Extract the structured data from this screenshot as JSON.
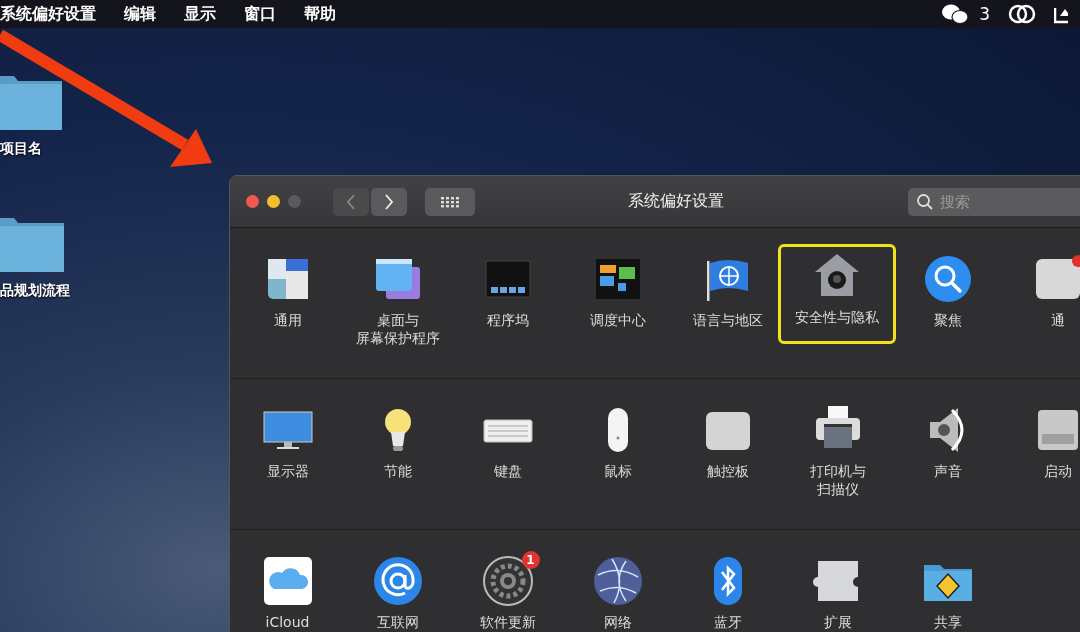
{
  "menu_bar": {
    "app_name": "系统偏好设置",
    "menus": [
      "编辑",
      "显示",
      "窗口",
      "帮助"
    ],
    "chat_count": "3"
  },
  "desktop_items": [
    {
      "label": "项目名"
    },
    {
      "label": "品规划流程"
    }
  ],
  "window": {
    "title": "系统偏好设置",
    "search": {
      "placeholder": "搜索"
    },
    "rows": [
      [
        {
          "label": "通用",
          "highlighted": false
        },
        {
          "label": [
            "桌面与",
            "屏幕保护程序"
          ],
          "highlighted": false
        },
        {
          "label": "程序坞",
          "highlighted": false
        },
        {
          "label": "调度中心",
          "highlighted": false
        },
        {
          "label": "语言与地区",
          "highlighted": false
        },
        {
          "label": "安全性与隐私",
          "highlighted": true
        },
        {
          "label": "聚焦",
          "highlighted": false
        },
        {
          "label": "通",
          "highlighted": false
        }
      ],
      [
        {
          "label": "显示器",
          "highlighted": false
        },
        {
          "label": "节能",
          "highlighted": false
        },
        {
          "label": "键盘",
          "highlighted": false
        },
        {
          "label": "鼠标",
          "highlighted": false
        },
        {
          "label": "触控板",
          "highlighted": false
        },
        {
          "label": [
            "打印机与",
            "扫描仪"
          ],
          "highlighted": false
        },
        {
          "label": "声音",
          "highlighted": false
        },
        {
          "label": "启动",
          "highlighted": false
        }
      ],
      [
        {
          "label": "iCloud",
          "highlighted": false
        },
        {
          "label": "互联网",
          "highlighted": false
        },
        {
          "label": "软件更新",
          "highlighted": false,
          "badge": "1"
        },
        {
          "label": "网络",
          "highlighted": false
        },
        {
          "label": "蓝牙",
          "highlighted": false
        },
        {
          "label": "扩展",
          "highlighted": false
        },
        {
          "label": "共享",
          "highlighted": false
        }
      ]
    ]
  }
}
